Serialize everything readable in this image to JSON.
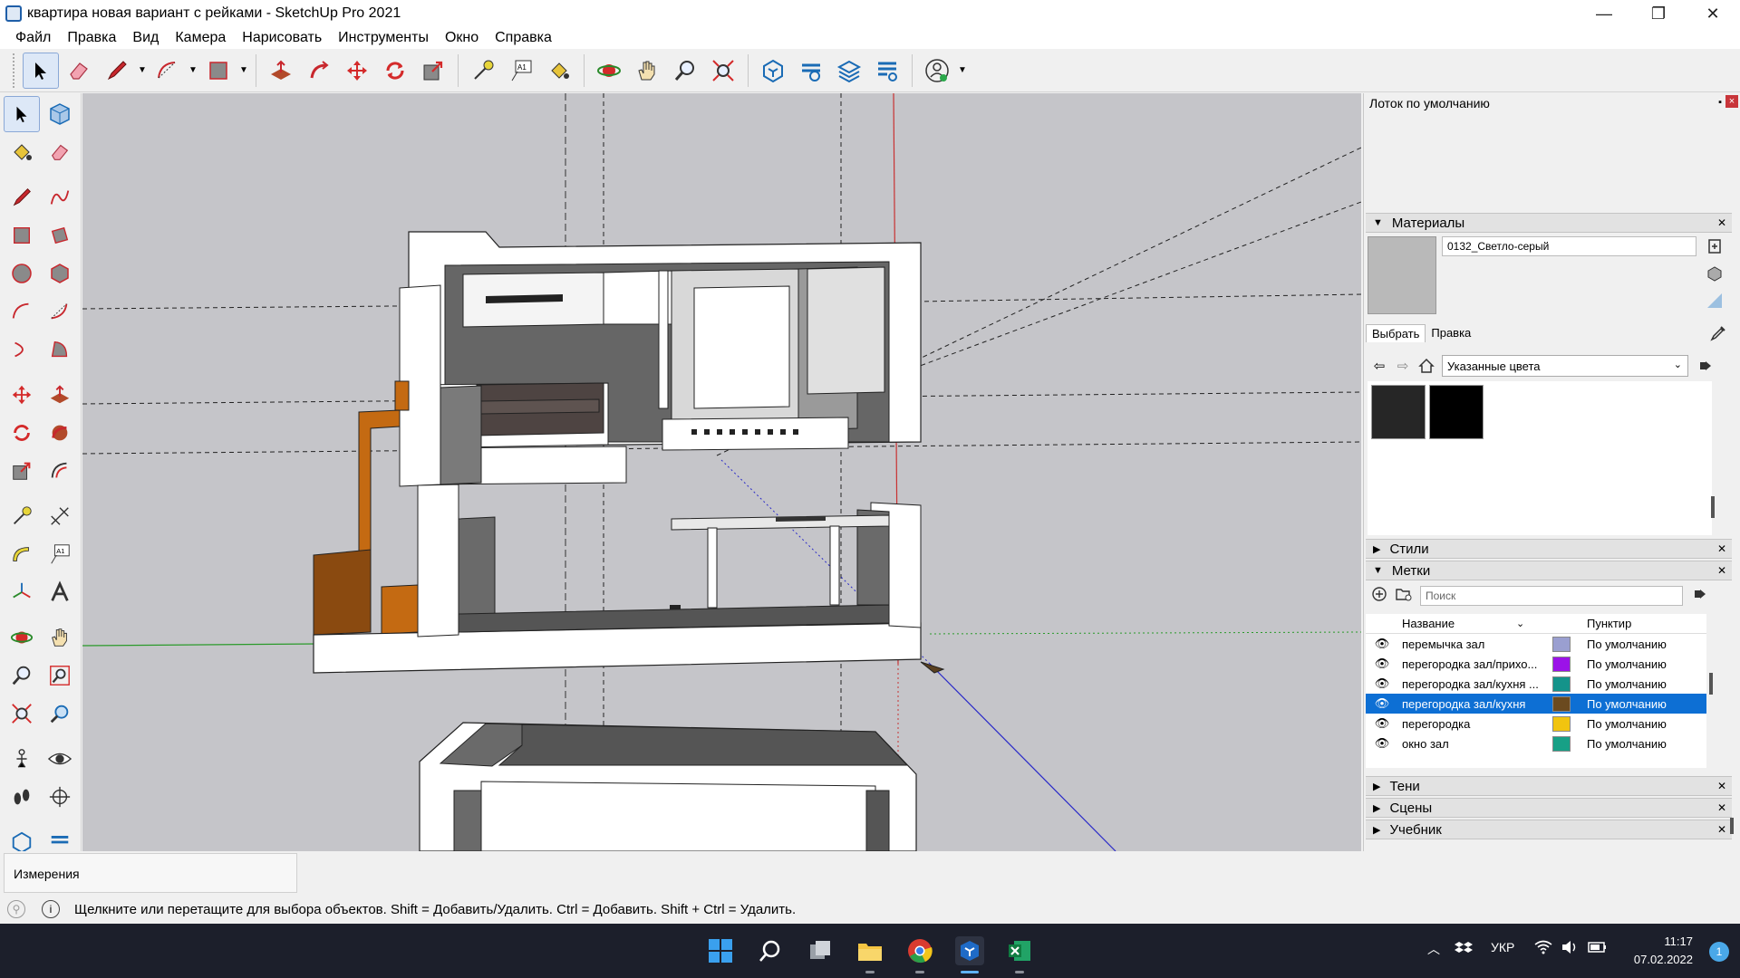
{
  "window": {
    "title": "квартира новая вариант с рейками - SketchUp Pro 2021",
    "minimize": "—",
    "restore": "❐",
    "close": "✕"
  },
  "menu": [
    "Файл",
    "Правка",
    "Вид",
    "Камера",
    "Нарисовать",
    "Инструменты",
    "Окно",
    "Справка"
  ],
  "tray": {
    "title": "Лоток по умолчанию",
    "pin": "▪",
    "close": "×",
    "materials": {
      "header": "Материалы",
      "current_material": "0132_Светло-серый",
      "tab_select": "Выбрать",
      "tab_edit": "Правка",
      "collection": "Указанные цвета",
      "swatch_colors": [
        "#262626",
        "#000000"
      ]
    },
    "styles_header": "Стили",
    "tags": {
      "header": "Метки",
      "search_placeholder": "Поиск",
      "col_name": "Название",
      "col_dash": "Пунктир",
      "rows": [
        {
          "name": "перемычка зал",
          "color": "#9a9fd0",
          "dash": "По умолчанию"
        },
        {
          "name": "перегородка зал/прихо...",
          "color": "#9b12e8",
          "dash": "По умолчанию"
        },
        {
          "name": "перегородка зал/кухня ...",
          "color": "#14938a",
          "dash": "По умолчанию"
        },
        {
          "name": "перегородка зал/кухня",
          "color": "#6b4a1f",
          "dash": "По умолчанию"
        },
        {
          "name": "перегородка",
          "color": "#f1c40f",
          "dash": "По умолчанию"
        },
        {
          "name": "окно зал",
          "color": "#17a086",
          "dash": "По умолчанию"
        }
      ]
    },
    "shadows_header": "Тени",
    "scenes_header": "Сцены",
    "tutorial_header": "Учебник"
  },
  "measurements_label": "Измерения",
  "status_text": "Щелкните или перетащите для выбора объектов. Shift = Добавить/Удалить. Ctrl = Добавить. Shift + Ctrl = Удалить.",
  "taskbar": {
    "language": "УКР",
    "time": "11:17",
    "date": "07.02.2022",
    "notifications": "1"
  }
}
